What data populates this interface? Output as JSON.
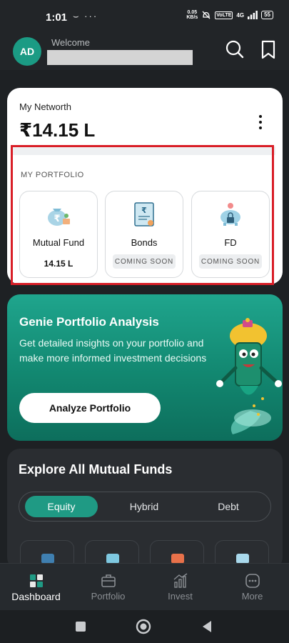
{
  "status_bar": {
    "time": "1:01",
    "extras": "⌣ ···",
    "net_speed_value": "0.05",
    "net_speed_unit": "KB/s",
    "volte": "VoLTE",
    "network": "4G",
    "battery": "55"
  },
  "header": {
    "avatar_initials": "AD",
    "welcome": "Welcome",
    "search_icon": "search-icon",
    "bookmark_icon": "bookmark-icon"
  },
  "networth": {
    "label": "My Networth",
    "value": "₹14.15 L"
  },
  "portfolio": {
    "title": "MY PORTFOLIO",
    "items": [
      {
        "label": "Mutual Fund",
        "value": "14.15 L",
        "icon": "money-bag-icon"
      },
      {
        "label": "Bonds",
        "badge": "COMING SOON",
        "icon": "bond-certificate-icon"
      },
      {
        "label": "FD",
        "badge": "COMING SOON",
        "icon": "piggy-bank-icon"
      }
    ],
    "highlight_color": "#d91e27"
  },
  "genie": {
    "title": "Genie Portfolio Analysis",
    "description": "Get detailed insights on your portfolio and make more informed investment decisions",
    "button": "Analyze Portfolio"
  },
  "explore": {
    "title": "Explore All Mutual Funds",
    "tabs": [
      "Equity",
      "Hybrid",
      "Debt"
    ],
    "active_tab": "Equity"
  },
  "bottom_nav": {
    "items": [
      {
        "label": "Dashboard",
        "icon": "dashboard-icon"
      },
      {
        "label": "Portfolio",
        "icon": "briefcase-icon"
      },
      {
        "label": "Invest",
        "icon": "invest-chart-icon"
      },
      {
        "label": "More",
        "icon": "more-icon"
      }
    ],
    "active": "Dashboard"
  },
  "colors": {
    "accent": "#1f9a84",
    "background": "#1e2124",
    "card": "#ffffff"
  }
}
